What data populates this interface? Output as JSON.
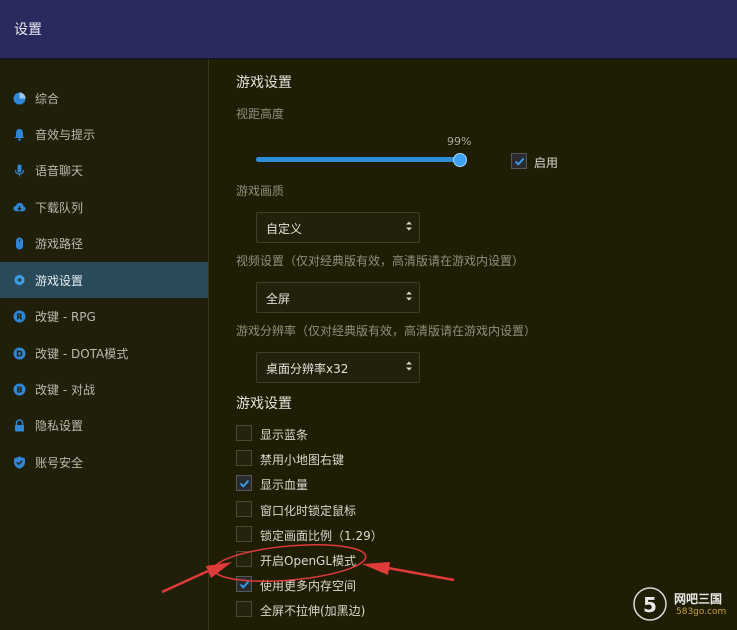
{
  "window": {
    "title": "设置"
  },
  "sidebar": {
    "items": [
      {
        "label": "综合",
        "icon": "pie-chart-icon"
      },
      {
        "label": "音效与提示",
        "icon": "bell-icon"
      },
      {
        "label": "语音聊天",
        "icon": "microphone-icon"
      },
      {
        "label": "下载队列",
        "icon": "cloud-download-icon"
      },
      {
        "label": "游戏路径",
        "icon": "mouse-icon"
      },
      {
        "label": "游戏设置",
        "icon": "gear-icon",
        "active": true
      },
      {
        "label": "改键 - RPG",
        "icon": "r-circle-icon"
      },
      {
        "label": "改键 - DOTA模式",
        "icon": "d-circle-icon"
      },
      {
        "label": "改键 - 对战",
        "icon": "b-circle-icon"
      },
      {
        "label": "隐私设置",
        "icon": "lock-icon"
      },
      {
        "label": "账号安全",
        "icon": "shield-icon"
      }
    ]
  },
  "main": {
    "section1_title": "游戏设置",
    "view_height": {
      "label": "视距高度",
      "value_text": "99%",
      "value": 0.99,
      "enable_label": "启用",
      "enabled": true
    },
    "quality": {
      "label": "游戏画质",
      "selected": "自定义"
    },
    "video": {
      "label": "视频设置（仅对经典版有效，高清版请在游戏内设置）",
      "selected": "全屏"
    },
    "resolution": {
      "label": "游戏分辨率（仅对经典版有效，高清版请在游戏内设置）",
      "selected": "桌面分辨率x32"
    },
    "section2_title": "游戏设置",
    "options": [
      {
        "label": "显示蓝条",
        "checked": false
      },
      {
        "label": "禁用小地图右键",
        "checked": false
      },
      {
        "label": "显示血量",
        "checked": true
      },
      {
        "label": "窗口化时锁定鼠标",
        "checked": false
      },
      {
        "label": "锁定画面比例（1.29）",
        "checked": false
      },
      {
        "label": "开启OpenGL模式",
        "checked": false
      },
      {
        "label": "使用更多内存空间",
        "checked": true
      },
      {
        "label": "全屏不拉伸(加黑边)",
        "checked": false
      }
    ]
  },
  "watermark": {
    "text": "网吧三国",
    "sub": "583go.com"
  },
  "colors": {
    "accent": "#2e8fd8",
    "annotation": "#e03a3a",
    "titlebar": "#2b2a5e"
  }
}
